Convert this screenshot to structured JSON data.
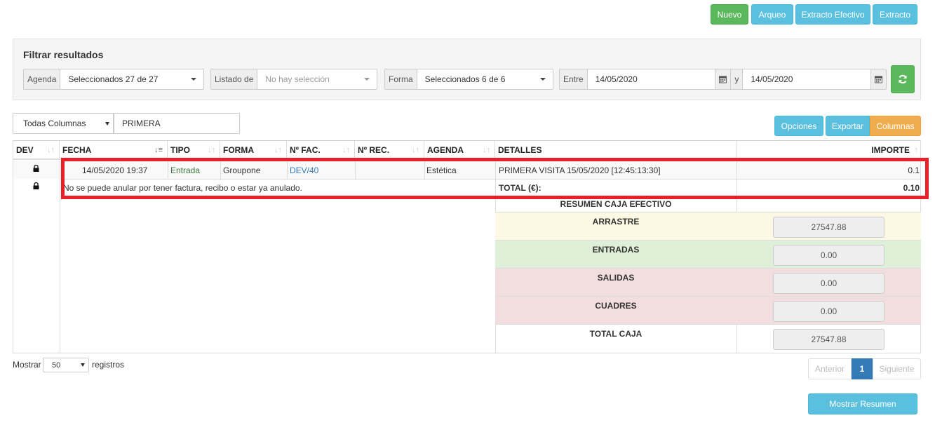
{
  "toolbar": {
    "nuevo": "Nuevo",
    "arqueo": "Arqueo",
    "extracto_efectivo": "Extracto Efectivo",
    "extracto": "Extracto"
  },
  "filters": {
    "title": "Filtrar resultados",
    "agenda_label": "Agenda",
    "agenda_value": "Seleccionados 27 de 27",
    "listado_label": "Listado de",
    "listado_value": "No hay selección",
    "forma_label": "Forma",
    "forma_value": "Seleccionados 6 de 6",
    "entre_label": "Entre",
    "date_from": "14/05/2020",
    "y_label": "y",
    "date_to": "14/05/2020"
  },
  "search": {
    "column_select": "Todas Columnas",
    "query": "PRIMERA"
  },
  "table_actions": {
    "opciones": "Opciones",
    "exportar": "Exportar",
    "columnas": "Columnas"
  },
  "table": {
    "columns": [
      "DEV",
      "FECHA",
      "TIPO",
      "FORMA",
      "Nº FAC.",
      "Nº REC.",
      "AGENDA",
      "DETALLES",
      "IMPORTE"
    ],
    "row": {
      "fecha": "14/05/2020 19:37",
      "tipo": "Entrada",
      "forma": "Groupone",
      "nfac": "DEV/40",
      "nrec": "",
      "agenda": "Estética",
      "detalles": "PRIMERA VISITA 15/05/2020 [12:45:13:30]",
      "importe": "0.1"
    },
    "note": "No se puede anular por tener factura, recibo o estar ya anulado.",
    "total_label": "TOTAL (€):",
    "total_value": "0.10"
  },
  "summary": {
    "title": "RESUMEN CAJA EFECTIVO",
    "arrastre_label": "ARRASTRE",
    "arrastre_value": "27547.88",
    "entradas_label": "ENTRADAS",
    "entradas_value": "0.00",
    "salidas_label": "SALIDAS",
    "salidas_value": "0.00",
    "cuadres_label": "CUADRES",
    "cuadres_value": "0.00",
    "total_label": "TOTAL CAJA",
    "total_value": "27547.88"
  },
  "footer": {
    "mostrar": "Mostrar",
    "page_size": "50",
    "registros": "registros",
    "anterior": "Anterior",
    "page": "1",
    "siguiente": "Siguiente",
    "mostrar_resumen": "Mostrar Resumen"
  },
  "colors": {
    "green": "#5cb85c",
    "blue": "#5bc0de",
    "orange": "#f0ad4e",
    "highlight": "#e8202a",
    "arrastre_bg": "#fcf8e3",
    "entradas_bg": "#dff0d8",
    "salidas_bg": "#f2dede"
  }
}
